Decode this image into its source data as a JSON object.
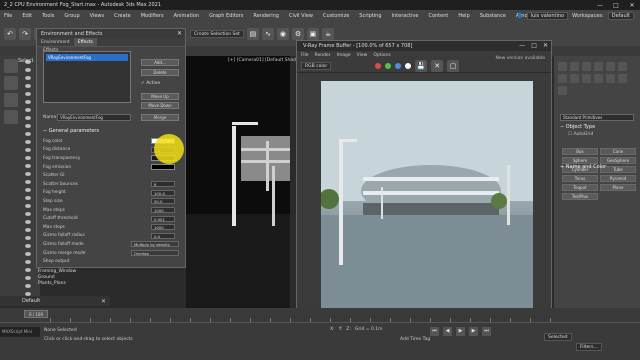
{
  "app": {
    "title": "2_2 CPU Environment Fog_Start.max - Autodesk 3ds Max 2021",
    "window_controls": [
      "—",
      "□",
      "✕"
    ]
  },
  "menubar": {
    "items": [
      "File",
      "Edit",
      "Tools",
      "Group",
      "Views",
      "Create",
      "Modifiers",
      "Animation",
      "Graph Editors",
      "Rendering",
      "Civil View",
      "Customize",
      "Scripting",
      "Interactive",
      "Content",
      "Help",
      "Substance",
      "Arnold"
    ],
    "user": "luis valentino",
    "workspaces_label": "Workspaces:",
    "workspace_value": "Default",
    "create_selection_set": "Create Selection Set"
  },
  "scene_explorer": {
    "select_label": "Select"
  },
  "viewport_left": {
    "label": "[+] [Camera01] [Default Shading]"
  },
  "env_dialog": {
    "title": "Environment and Effects",
    "tabs": [
      "Environment",
      "Effects"
    ],
    "effects_label": "Effects",
    "effect_item": "VRayEnvironmentFog",
    "buttons": {
      "add": "Add...",
      "delete": "Delete",
      "move_up": "Move Up",
      "move_down": "Move Down",
      "merge": "Merge"
    },
    "active_label": "Active",
    "name_label": "Name:",
    "name_value": "VRayEnvironmentFog",
    "section_title": "General parameters",
    "params": [
      {
        "label": "Fog color",
        "kind": "swatch",
        "value": ""
      },
      {
        "label": "Fog distance",
        "kind": "value",
        "value": "1.0"
      },
      {
        "label": "Fog transparency",
        "kind": "swatch",
        "value": ""
      },
      {
        "label": "Fog emission",
        "kind": "swatch",
        "value": ""
      },
      {
        "label": "Scatter GI",
        "kind": "none",
        "value": ""
      },
      {
        "label": "Scatter bounces",
        "kind": "value",
        "value": "8"
      },
      {
        "label": "Fog height",
        "kind": "value",
        "value": "100.0"
      },
      {
        "label": "Step size",
        "kind": "value",
        "value": "50.0"
      },
      {
        "label": "Max steps",
        "kind": "value",
        "value": "1000"
      },
      {
        "label": "Cutoff threshold",
        "kind": "value",
        "value": "0.001"
      },
      {
        "label": "Max steps",
        "kind": "value",
        "value": "1000"
      },
      {
        "label": "Gizmo falloff radius",
        "kind": "value",
        "value": "0.0"
      },
      {
        "label": "Gizmo falloff mode",
        "kind": "dropdown",
        "value": "Multiply by density"
      },
      {
        "label": "Gizmo merge mode",
        "kind": "dropdown",
        "value": "Overlap"
      },
      {
        "label": "Shop output",
        "kind": "none",
        "value": ""
      }
    ]
  },
  "scene_items": [
    "Framing_Window",
    "Ground",
    "Plants_Plans"
  ],
  "default_row": {
    "label": "Default"
  },
  "vfb": {
    "title": "V-Ray Frame Buffer - [100.0% of 657 x 708]",
    "menu": [
      "File",
      "Render",
      "Image",
      "View",
      "Options"
    ],
    "status": "New version available",
    "channel": "RGB color",
    "dot_colors": [
      "#e24a4a",
      "#57c04b",
      "#4a8fe2",
      "#ffffff"
    ]
  },
  "rightpanel": {
    "dropdown": "Standard Primitives",
    "object_type_title": "Object Type",
    "autogrid": "AutoGrid",
    "objects": [
      "Box",
      "Cone",
      "Sphere",
      "GeoSphere",
      "Cylinder",
      "Tube",
      "Torus",
      "Pyramid",
      "Teapot",
      "Plane",
      "TextPlus"
    ],
    "name_color_title": "Name and Color"
  },
  "timeline": {
    "slider": "0 / 100"
  },
  "statusbar": {
    "maxscript": "MAXScript Mini",
    "line1": "None Selected",
    "line2": "Click or click-and-drag to select objects",
    "x": "X:",
    "y": "Y:",
    "z": "Z:",
    "grid": "Grid = 0.1m",
    "add_time_tag": "Add Time Tag",
    "selected": "Selected",
    "filters": "Filters..."
  },
  "colors": {
    "accent": "#2c6fc9",
    "highlight": "#f0dc14"
  }
}
